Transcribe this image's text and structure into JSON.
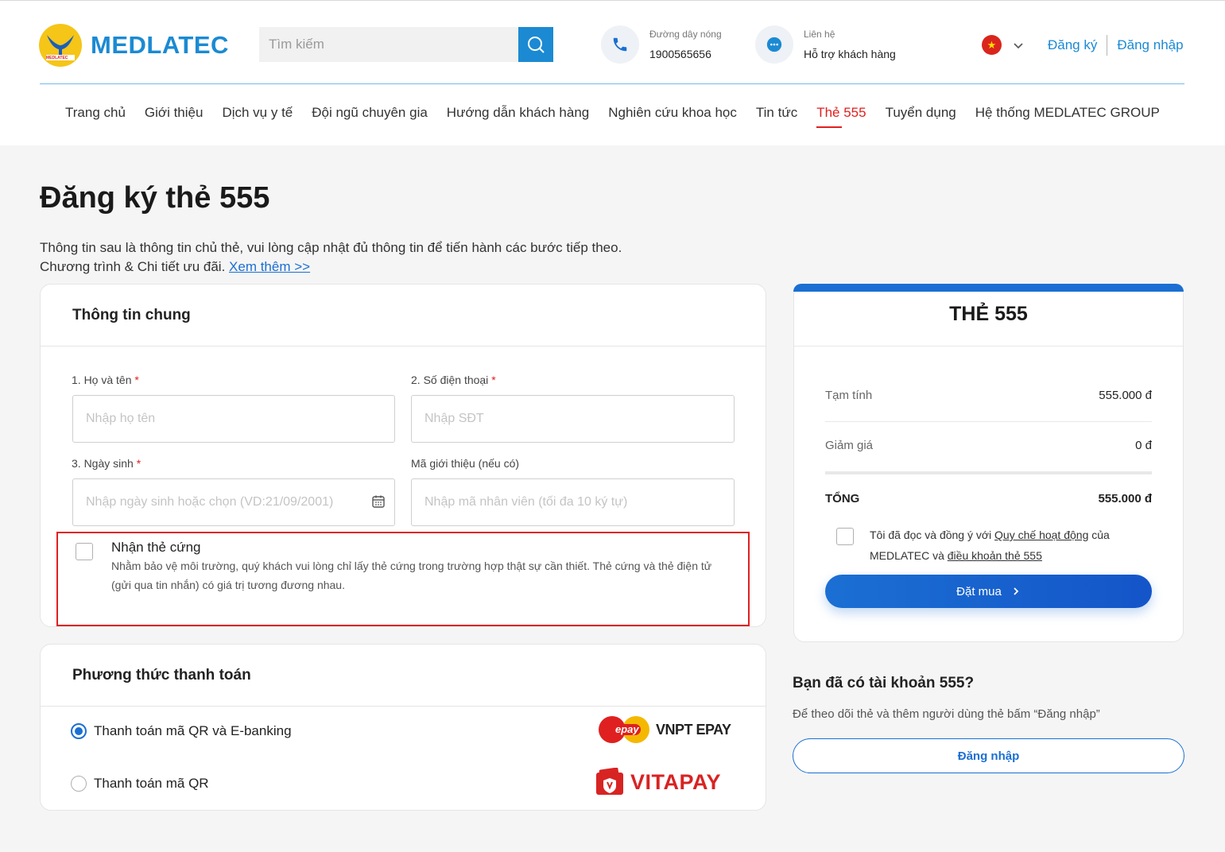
{
  "header": {
    "logo_text": "MEDLATEC",
    "logo_small": "MEDLATEC",
    "search_placeholder": "Tìm kiếm",
    "hotline_label": "Đường dây nóng",
    "hotline_number": "1900565656",
    "support_label": "Liên hệ",
    "support_text": "Hỗ trợ khách hàng",
    "register": "Đăng ký",
    "login": "Đăng nhập"
  },
  "nav": [
    "Trang chủ",
    "Giới thiệu",
    "Dịch vụ y tế",
    "Đội ngũ chuyên gia",
    "Hướng dẫn khách hàng",
    "Nghiên cứu khoa học",
    "Tin tức",
    "Thẻ 555",
    "Tuyển dụng",
    "Hệ thống MEDLATEC GROUP"
  ],
  "nav_active": "Thẻ 555",
  "page": {
    "title": "Đăng ký thẻ 555",
    "intro_line1": "Thông tin sau là thông tin chủ thẻ, vui lòng cập nhật đủ thông tin để tiến hành các bước tiếp theo.",
    "intro_line2": "Chương trình & Chi tiết ưu đãi.",
    "intro_link": "Xem thêm >>"
  },
  "general": {
    "heading": "Thông tin chung",
    "name_label": "1. Họ và tên",
    "name_placeholder": "Nhập họ tên",
    "phone_label": "2. Số điện thoại",
    "phone_placeholder": "Nhập SĐT",
    "dob_label": "3. Ngày sinh",
    "dob_placeholder": "Nhập ngày sinh hoặc chọn (VD:21/09/2001)",
    "referral_label": "Mã giới thiệu (nếu có)",
    "referral_placeholder": "Nhập mã nhân viên (tối đa 10 ký tự)",
    "required_mark": "*",
    "hard_card_title": "Nhận thẻ cứng",
    "hard_card_desc": "Nhằm bảo vệ môi trường, quý khách vui lòng chỉ lấy thẻ cứng trong trường hợp thật sự cần thiết. Thẻ cứng và thẻ điện tử (gửi qua tin nhắn) có giá trị tương đương nhau."
  },
  "payment": {
    "heading": "Phương thức thanh toán",
    "options": [
      {
        "label": "Thanh toán mã QR và E-banking",
        "selected": true,
        "logo": "VNPT EPAY",
        "logo_badge": "epay"
      },
      {
        "label": "Thanh toán mã QR",
        "selected": false,
        "logo": "VITAPAY"
      }
    ]
  },
  "summary": {
    "title": "THẺ 555",
    "subtotal_label": "Tạm tính",
    "subtotal_value": "555.000 đ",
    "discount_label": "Giảm giá",
    "discount_value": "0 đ",
    "total_label": "TỔNG",
    "total_value": "555.000 đ",
    "agree_prefix": "Tôi đã đọc và đồng ý với",
    "agree_link1": "Quy chế hoạt động",
    "agree_mid": "của MEDLATEC và",
    "agree_link2": "điều khoản thẻ 555",
    "order_button": "Đặt mua",
    "account_title": "Bạn đã có tài khoản 555?",
    "account_desc": "Để theo dõi thẻ và thêm người dùng thẻ bấm “Đăng nhập”",
    "account_login": "Đăng nhập"
  },
  "colors": {
    "brand_blue": "#1b8ad3",
    "button_blue": "#1b6fd3",
    "active_red": "#e02020",
    "highlight_red": "#e02020"
  }
}
